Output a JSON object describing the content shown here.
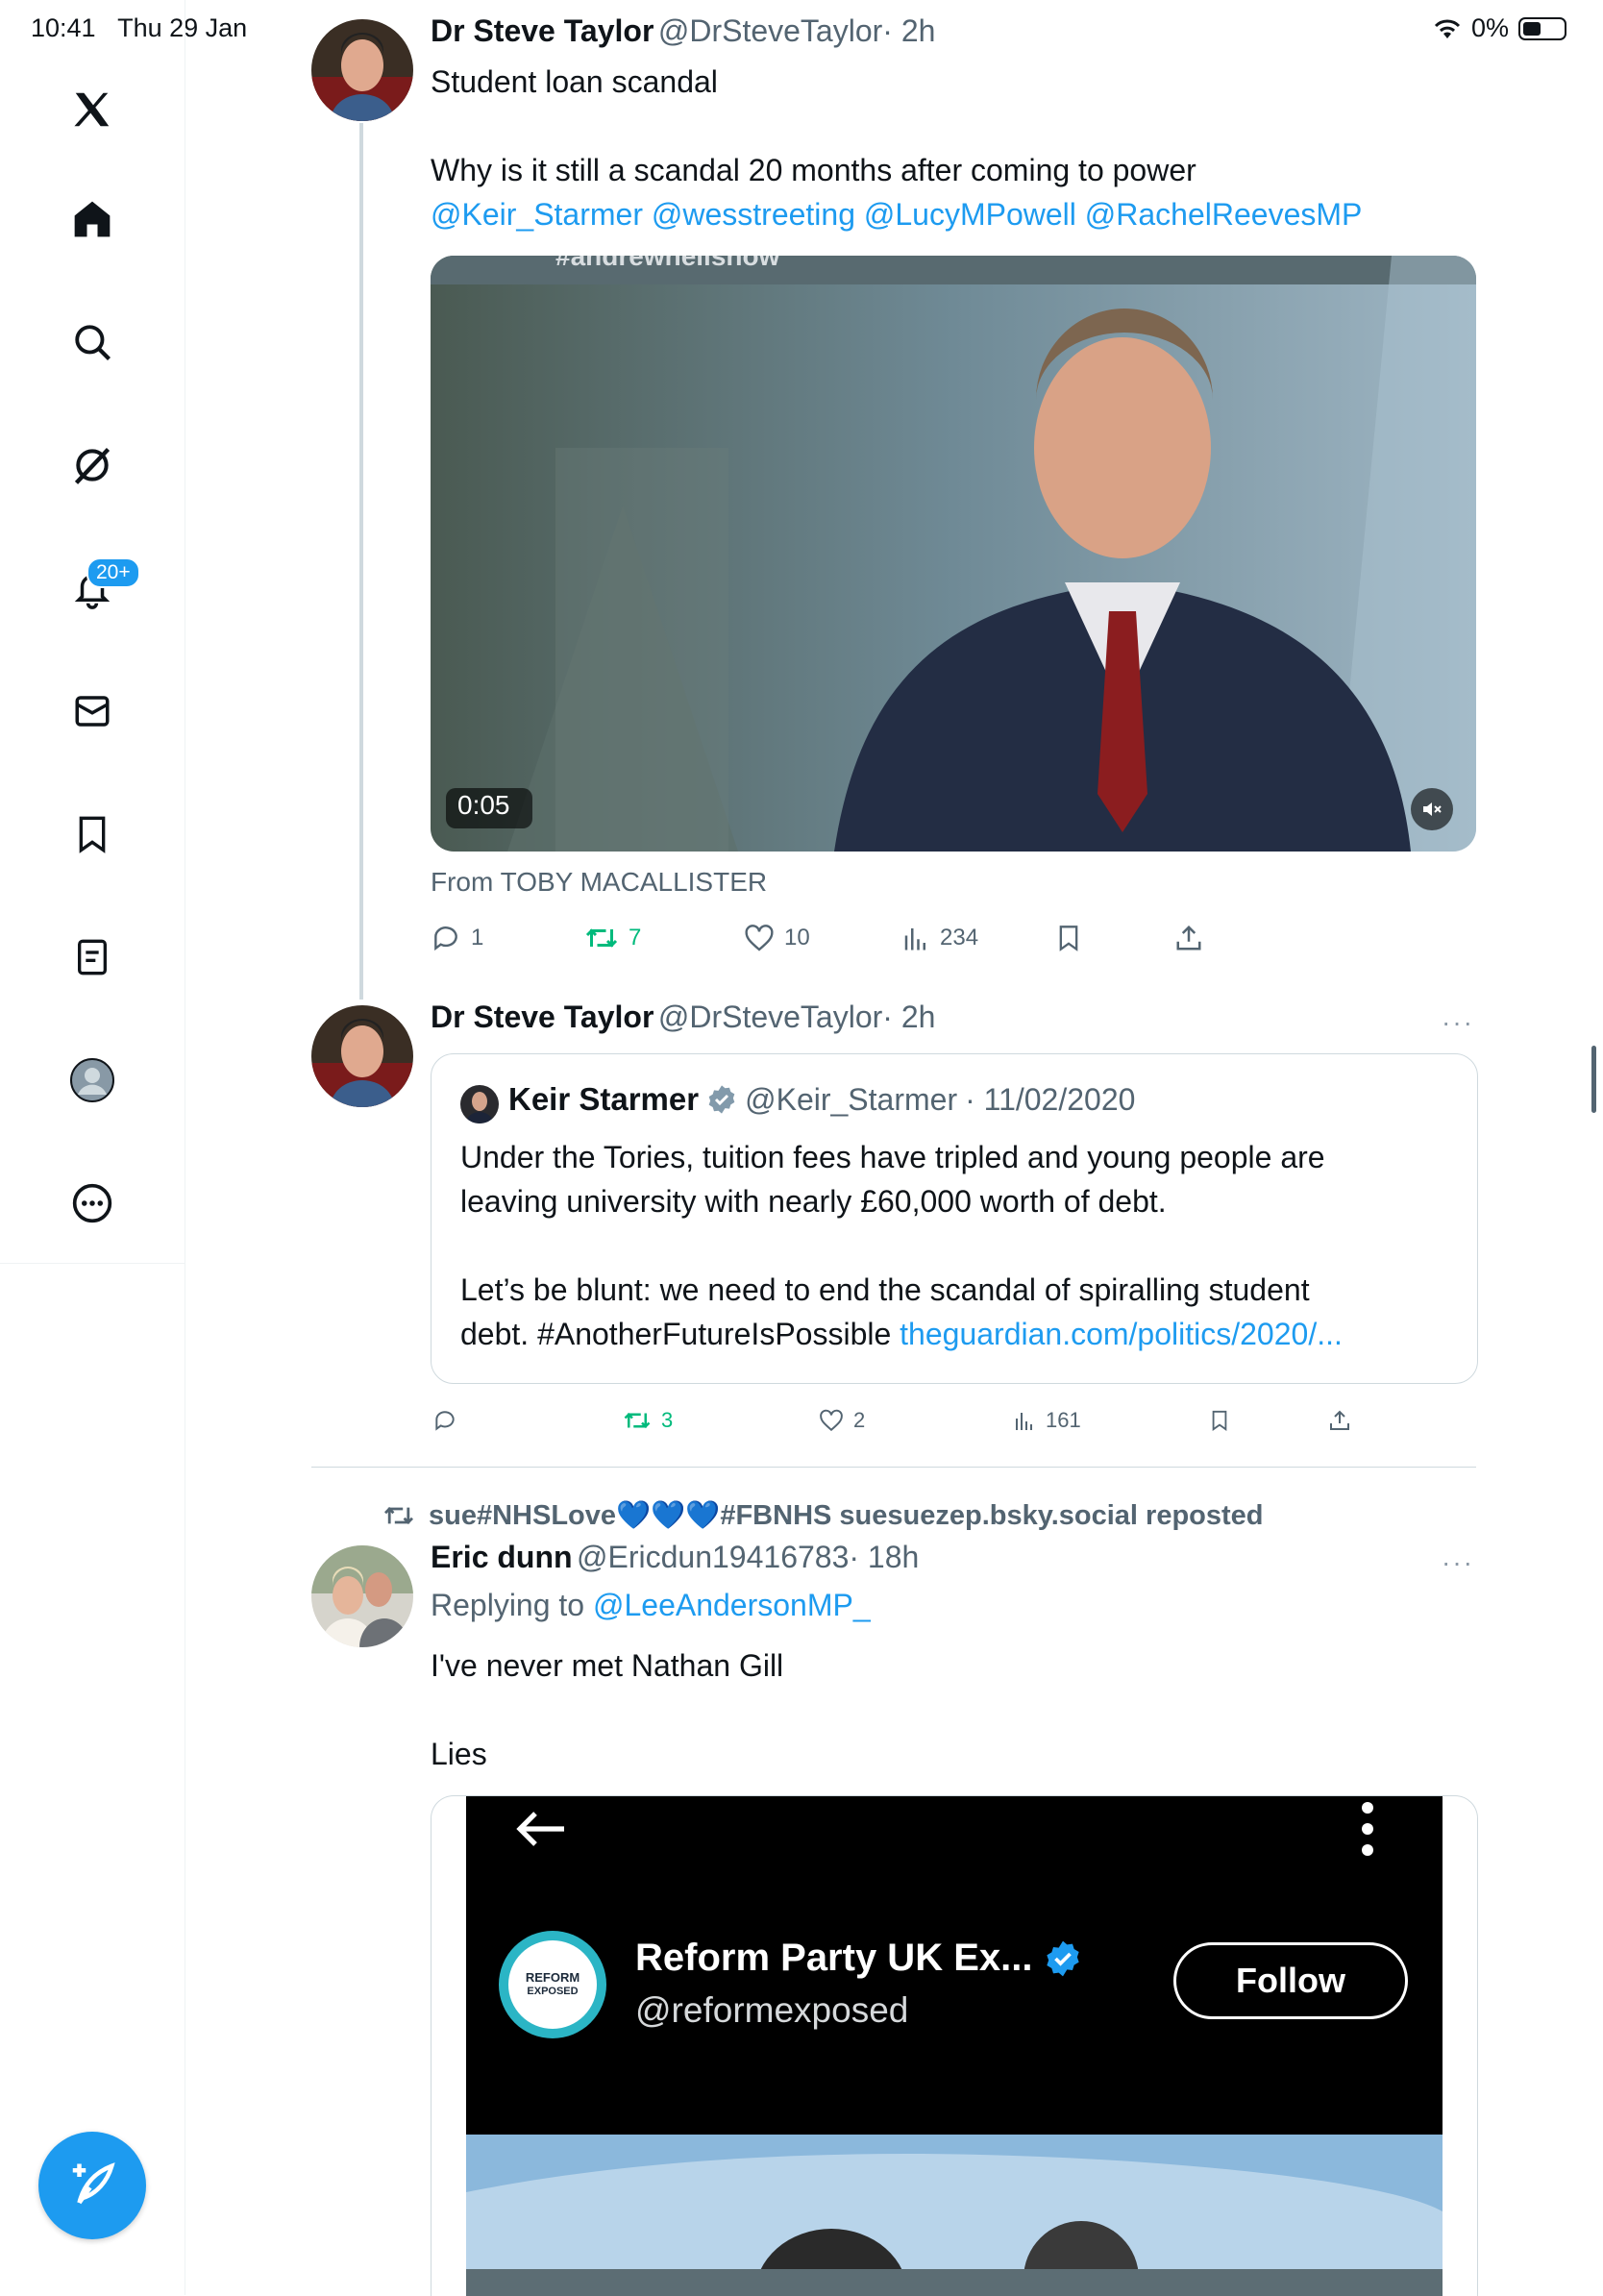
{
  "status_bar": {
    "time": "10:41",
    "date": "Thu 29 Jan",
    "battery": "0%"
  },
  "sidebar": {
    "items": [
      {
        "icon": "x-logo-icon"
      },
      {
        "icon": "home-icon"
      },
      {
        "icon": "search-icon"
      },
      {
        "icon": "grok-icon"
      },
      {
        "icon": "notifications-icon"
      },
      {
        "icon": "messages-icon"
      },
      {
        "icon": "bookmark-icon"
      },
      {
        "icon": "lists-icon"
      },
      {
        "icon": "profile-icon"
      },
      {
        "icon": "more-icon"
      }
    ],
    "notification_badge": "20+",
    "compose_icon": "compose-icon"
  },
  "tweets": [
    {
      "name": "Dr Steve Taylor",
      "handle": "@DrSteveTaylor",
      "time": "· 2h",
      "text_line1": "Student loan scandal",
      "text_line2": "Why is it still a scandal 20 months after coming to power",
      "mentions": "@Keir_Starmer @wesstreeting @LucyMPowell @RachelReevesMP",
      "video_time": "0:05",
      "video_banner": "#andrewneilshow",
      "from_label": "From TOBY MACALLISTER",
      "replies": "1",
      "reposts": "7",
      "likes": "10",
      "views": "234"
    },
    {
      "name": "Dr Steve Taylor",
      "handle": "@DrSteveTaylor",
      "time": "· 2h",
      "more": "···",
      "quote": {
        "name": "Keir Starmer",
        "handle": "@Keir_Starmer",
        "time": "· 11/02/2020",
        "text1": "Under the Tories, tuition fees have tripled and young people are",
        "text2": "leaving university with nearly £60,000 worth of debt.",
        "text3": "Let’s be blunt: we need to end the scandal of spiralling student",
        "text4": "debt. #AnotherFutureIsPossible ",
        "link": "theguardian.com/politics/2020/..."
      },
      "replies": "",
      "reposts": "3",
      "likes": "2",
      "views": "161"
    },
    {
      "repost_label": "sue#NHSLove💙💙💙#FBNHS suesuezep.bsky.social reposted",
      "name": "Eric dunn",
      "handle": "@Ericdun19416783",
      "time": "· 18h",
      "more": "···",
      "replying_prefix": "Replying to ",
      "replying_to": "@LeeAndersonMP_",
      "text1": "I've never met Nathan Gill",
      "text2": "Lies",
      "embed": {
        "account_name": "Reform Party UK Ex...",
        "account_handle": "@reformexposed",
        "follow_label": "Follow",
        "logo_text1": "REFORM",
        "logo_text2": "EXPOSED"
      }
    }
  ]
}
